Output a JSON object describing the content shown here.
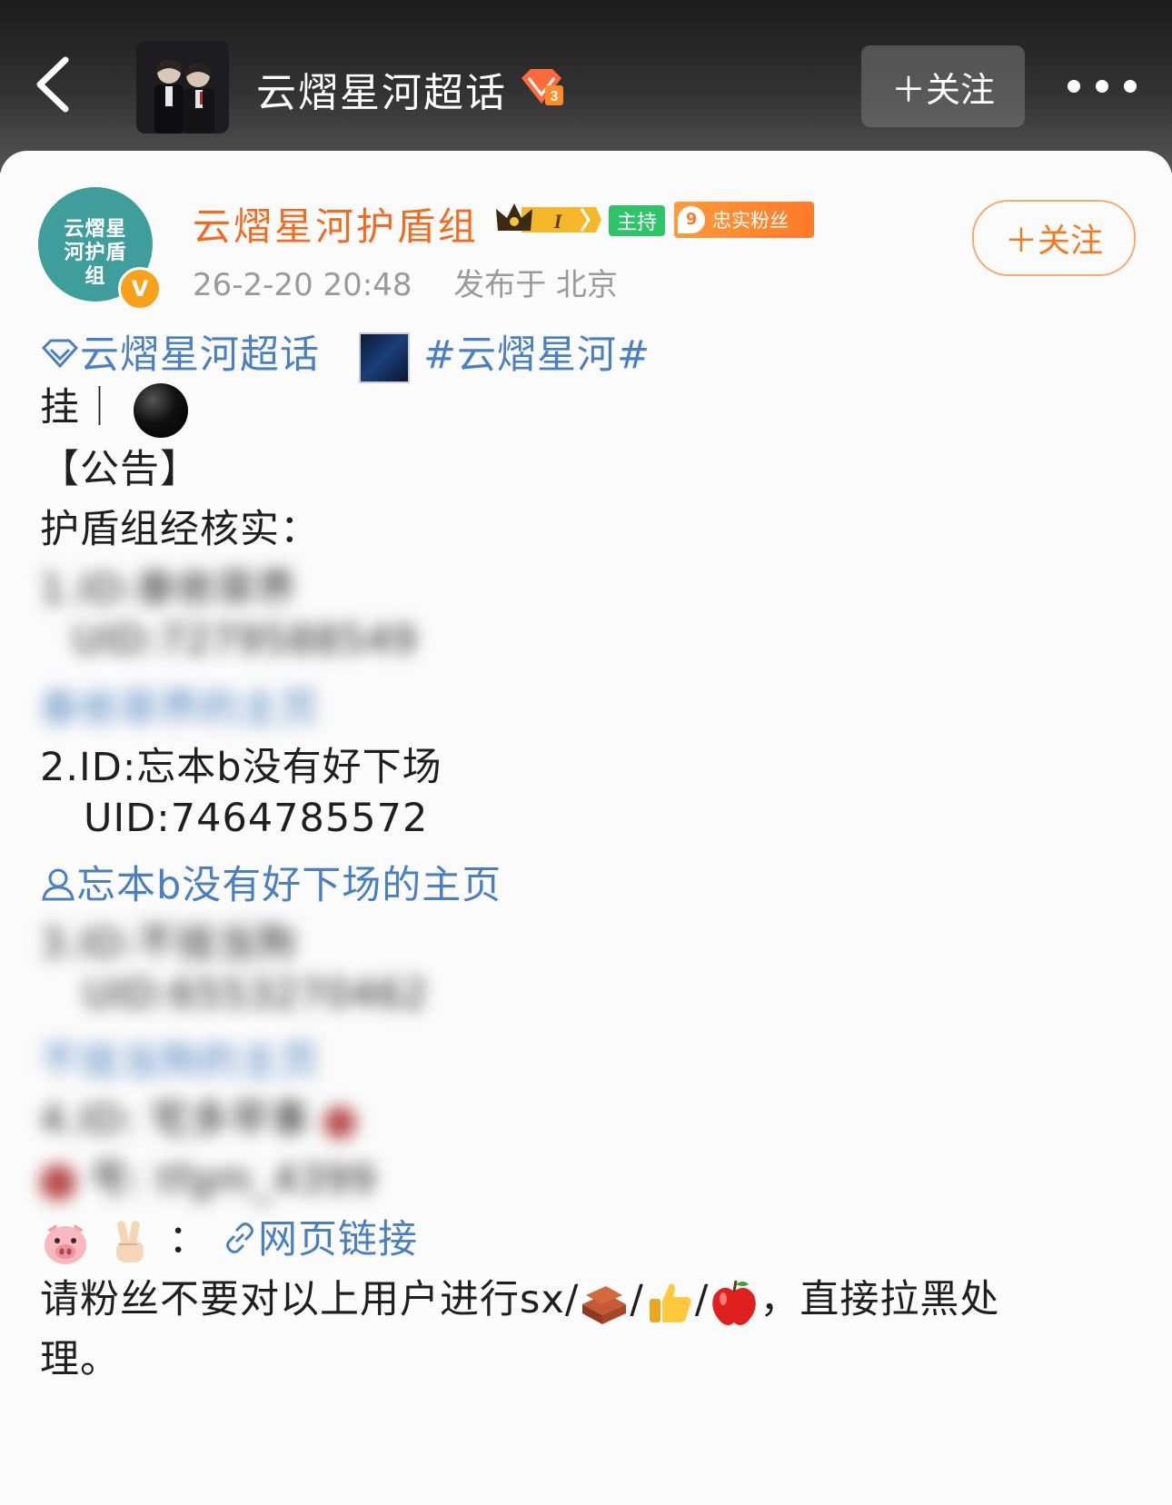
{
  "topbar": {
    "title": "云熠星河超话",
    "follow_label": "＋关注",
    "badge_level": "3"
  },
  "post": {
    "author": "云熠星河护盾组",
    "avatar_text": "云熠星河护盾组",
    "verified_label": "V",
    "crown_level": "I",
    "host_badge": "主持",
    "fan_badge_level": "9",
    "fan_badge_label": "忠实粉丝",
    "timestamp": "26-2-20 20:48",
    "location": "发布于 北京",
    "follow_label": "＋关注"
  },
  "content": {
    "supertopic_link": "云熠星河超话",
    "hashtag": "#云熠星河#",
    "line_gua": "挂｜",
    "announcement": "【公告】",
    "verified_intro": "护盾组经核实：",
    "blurred_1_id": "1.ID:泰依菲界",
    "blurred_1_uid": "UID:7279588549",
    "blurred_1_link": "泰依菲界的主页",
    "entry2_id": "2.ID:忘本b没有好下场",
    "entry2_uid": "UID:7464785572",
    "entry2_link": "忘本b没有好下场的主页",
    "blurred_3_id": "3.ID:不挂当狗",
    "blurred_3_uid": "UID:6553270462",
    "blurred_3_link": "不挂当狗的主页",
    "blurred_4_id": "4.ID: 宅多早事",
    "blurred_4_extra": "号: tfgm_4399",
    "web_link_prefix": "：",
    "web_link": "网页链接",
    "notice_text_1": "请粉丝不要对以上用户进行sx/",
    "sep": "/",
    "notice_text_2": "，直接拉黑处",
    "notice_text_3": "理。"
  },
  "colors": {
    "username": "#f26b20",
    "link": "#4a7fc1",
    "host_badge": "#2fc46a",
    "fan_badge": "#ff7a2a"
  },
  "icons": [
    "back-icon",
    "more-icon",
    "supertopic-diamond-icon",
    "user-icon",
    "link-icon",
    "pig-emoji",
    "victory-emoji",
    "brick-emoji",
    "thumbs-up-emoji",
    "apple-emoji"
  ]
}
